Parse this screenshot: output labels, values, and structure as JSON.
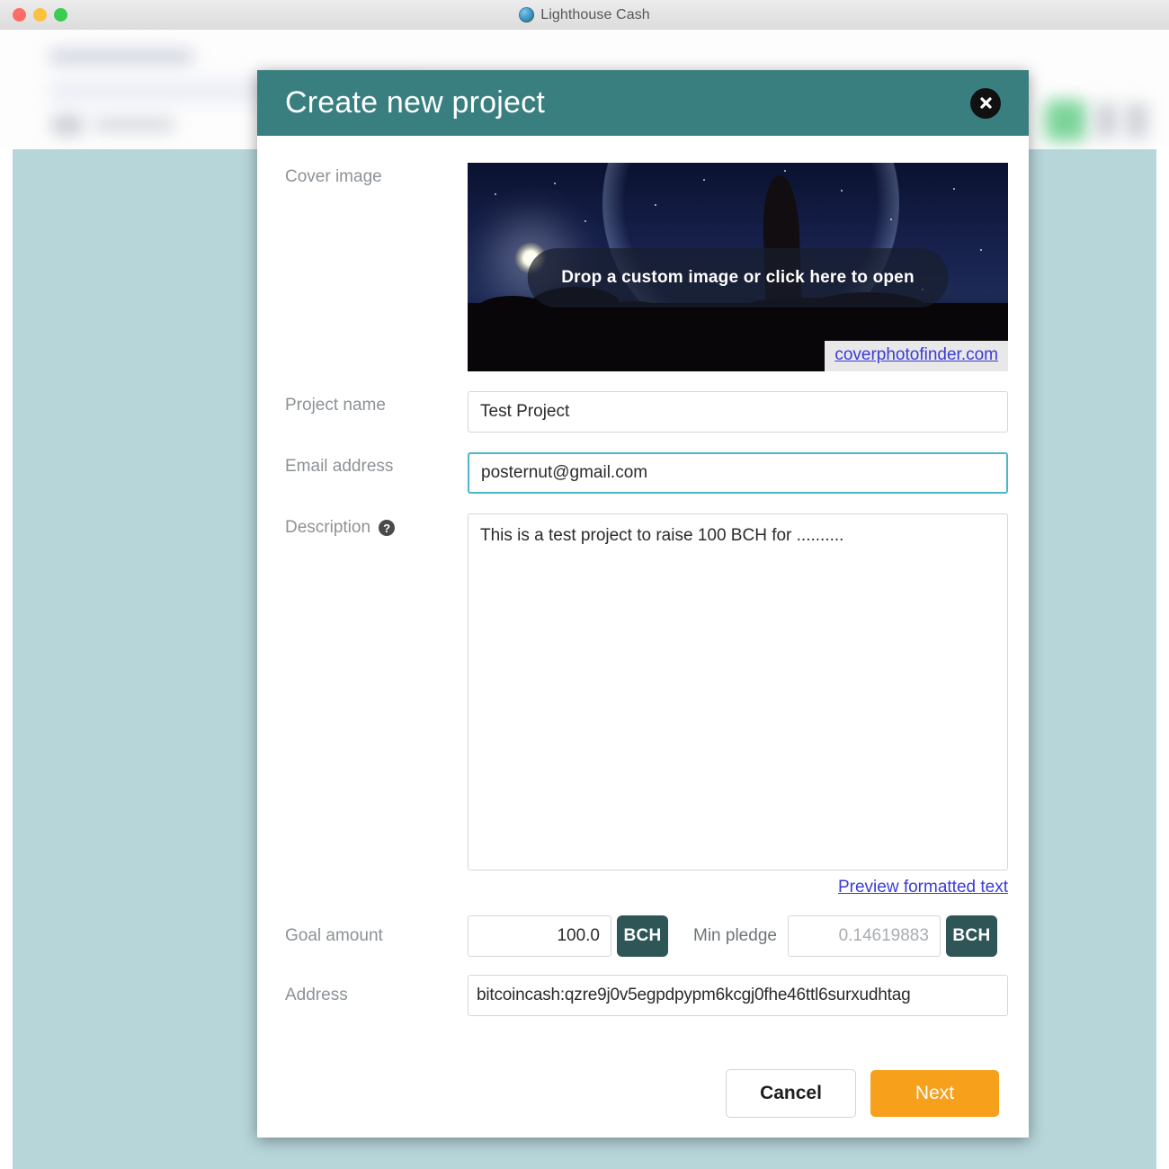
{
  "window": {
    "app_title": "Lighthouse Cash",
    "app_icon": "lighthouse-icon",
    "traffic_lights": [
      {
        "name": "close",
        "color": "#ff5f57"
      },
      {
        "name": "minimize",
        "color": "#ffbd2e"
      },
      {
        "name": "zoom",
        "color": "#28c940"
      }
    ]
  },
  "modal": {
    "title": "Create new project",
    "header_color": "#3a7f80",
    "close_icon": "close-icon",
    "fields": {
      "cover_image": {
        "label": "Cover image",
        "drop_text": "Drop a custom image or click here to open",
        "credit_link": "coverphotofinder.com"
      },
      "project_name": {
        "label": "Project name",
        "value": "Test Project",
        "focused": false
      },
      "email_address": {
        "label": "Email address",
        "value": "posternut@gmail.com",
        "focused": true
      },
      "description": {
        "label": "Description",
        "help_icon": "question-mark-icon",
        "help_glyph": "?",
        "value": "This is a test project to raise 100 BCH for ..........",
        "preview_link": "Preview formatted text"
      },
      "goal_amount": {
        "label": "Goal amount",
        "value": "100.0",
        "currency": "BCH"
      },
      "min_pledge": {
        "label": "Min pledge",
        "value": "0.14619883",
        "currency": "BCH"
      },
      "address": {
        "label": "Address",
        "value": "bitcoincash:qzre9j0v5egpdpypm6kcgj0fhe46ttl6surxudhtag"
      }
    },
    "buttons": {
      "cancel": "Cancel",
      "next": "Next",
      "next_color": "#f6a01b"
    }
  },
  "theme": {
    "accent_teal": "#3a7f80",
    "badge_teal": "#2f5657",
    "focus_border": "#4db6c8",
    "link_blue": "#3b3bd8",
    "page_background": "#b7d6da"
  }
}
